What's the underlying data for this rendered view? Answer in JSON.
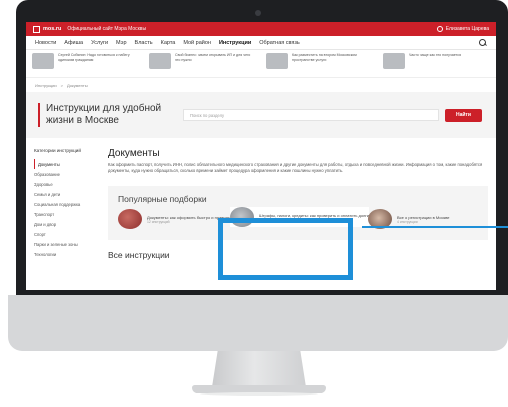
{
  "topbar": {
    "brand": "mos.ru",
    "tagline": "Официальный сайт Мэра Москвы",
    "user": "Елизавета Царева"
  },
  "nav": {
    "items": [
      "Новости",
      "Афиша",
      "Услуги",
      "Мэр",
      "Власть",
      "Карта",
      "Мой район",
      "Инструкции",
      "Обратная связь"
    ],
    "active_index": 7
  },
  "news": [
    {
      "text": "Сергей Собянин: Надо готовиться к набегу одиноким гражданам"
    },
    {
      "text": "Свой бизнес: зачем открывать ИП и для чего это нужно"
    },
    {
      "text": "Как разместить на втором Московском пространстве услуги"
    },
    {
      "text": "Часто чаще как это получается"
    }
  ],
  "breadcrumb": {
    "items": [
      "Инструкции",
      "Документы"
    ],
    "separator": ">"
  },
  "hero": {
    "title": "Инструкции для удобной жизни в Москве",
    "search_placeholder": "Поиск по разделу",
    "search_button": "Найти"
  },
  "sidebar": {
    "header": "Категории инструкций",
    "items": [
      "Документы",
      "Образование",
      "Здоровье",
      "Семья и дети",
      "Социальная поддержка",
      "Транспорт",
      "Дом и двор",
      "Спорт",
      "Парки и зеленые зоны",
      "Технологии"
    ],
    "selected_index": 0
  },
  "main": {
    "title": "Документы",
    "description": "Как оформить паспорт, получить ИНН, полис обязательного медицинского страхования и другие документы для работы, отдыха и повседневной жизни. Информация о том, какие понадобятся документы, куда нужно обращаться, сколько времени займет процедура оформления и какие пошлины нужно уплатить.",
    "popular_title": "Популярные подборки",
    "cards": [
      {
        "title": "Документы: как оформить быстро и правильно",
        "count": "12 инструкций"
      },
      {
        "title": "Штрафы, налоги, кредиты: как проверить и оплатить долги",
        "count": "8 инструкций"
      },
      {
        "title": "Все о регистрации в Москве",
        "count": "4 инструкции"
      }
    ],
    "all_title": "Все инструкции"
  },
  "colors": {
    "brand_red": "#cc2029",
    "highlight_blue": "#1e8fd8"
  }
}
